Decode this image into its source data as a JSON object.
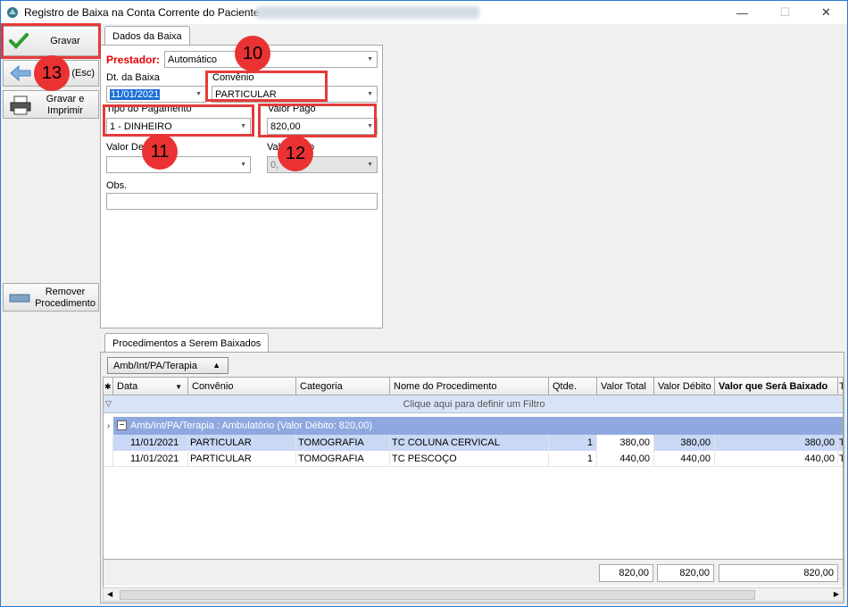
{
  "window": {
    "title": "Registro de Baixa na Conta Corrente do Paciente"
  },
  "toolbar": {
    "gravar": "Gravar",
    "voltar": "Voltar (Esc)",
    "gravar_imprimir_1": "Gravar e",
    "gravar_imprimir_2": "Imprimir",
    "remover_1": "Remover",
    "remover_2": "Procedimento"
  },
  "form": {
    "tab": "Dados da Baixa",
    "prestador_label": "Prestador:",
    "prestador_value": "Automático",
    "dt_baixa_label": "Dt. da Baixa",
    "dt_baixa_value": "11/01/2021",
    "convenio_label": "Convênio",
    "convenio_value": "PARTICULAR",
    "tipo_pagamento_label": "Tipo do Pagamento",
    "tipo_pagamento_value": "1 - DINHEIRO",
    "valor_pago_label": "Valor Pago",
    "valor_pago_value": "820,00",
    "valor_desconto_label_a": "Valor Des",
    "valor_troco_label_a": "Val",
    "valor_troco_label_b": "o",
    "valor_troco_value": "0,",
    "obs_label": "Obs."
  },
  "annotations": [
    "10",
    "11",
    "12",
    "13"
  ],
  "procedures": {
    "tab": "Procedimentos a Serem Baixados",
    "group_by": "Amb/Int/PA/Terapia",
    "columns": [
      "Data",
      "Convênio",
      "Categoria",
      "Nome do Procedimento",
      "Qtde.",
      "Valor Total",
      "Valor Débito",
      "Valor que Será Baixado",
      "T"
    ],
    "filter_hint": "Clique aqui para definir um Filtro",
    "group_label": "Amb/Int/PA/Terapia : Ambulatório (Valor Débito: 820,00)",
    "rows": [
      {
        "data": "11/01/2021",
        "convenio": "PARTICULAR",
        "categoria": "TOMOGRAFIA",
        "nome": "TC COLUNA CERVICAL",
        "qtde": "1",
        "valor_total": "380,00",
        "valor_debito": "380,00",
        "valor_baixado": "380,00",
        "t": "T"
      },
      {
        "data": "11/01/2021",
        "convenio": "PARTICULAR",
        "categoria": "TOMOGRAFIA",
        "nome": "TC PESCOÇO",
        "qtde": "1",
        "valor_total": "440,00",
        "valor_debito": "440,00",
        "valor_baixado": "440,00",
        "t": "T"
      }
    ],
    "totals": {
      "valor_total": "820,00",
      "valor_debito": "820,00",
      "valor_baixado": "820,00"
    }
  },
  "colors": {
    "annotation": "#e53b3b",
    "selection": "#1c6fd9",
    "group_row": "#8fa8e0",
    "prestador_label": "#e00000"
  }
}
